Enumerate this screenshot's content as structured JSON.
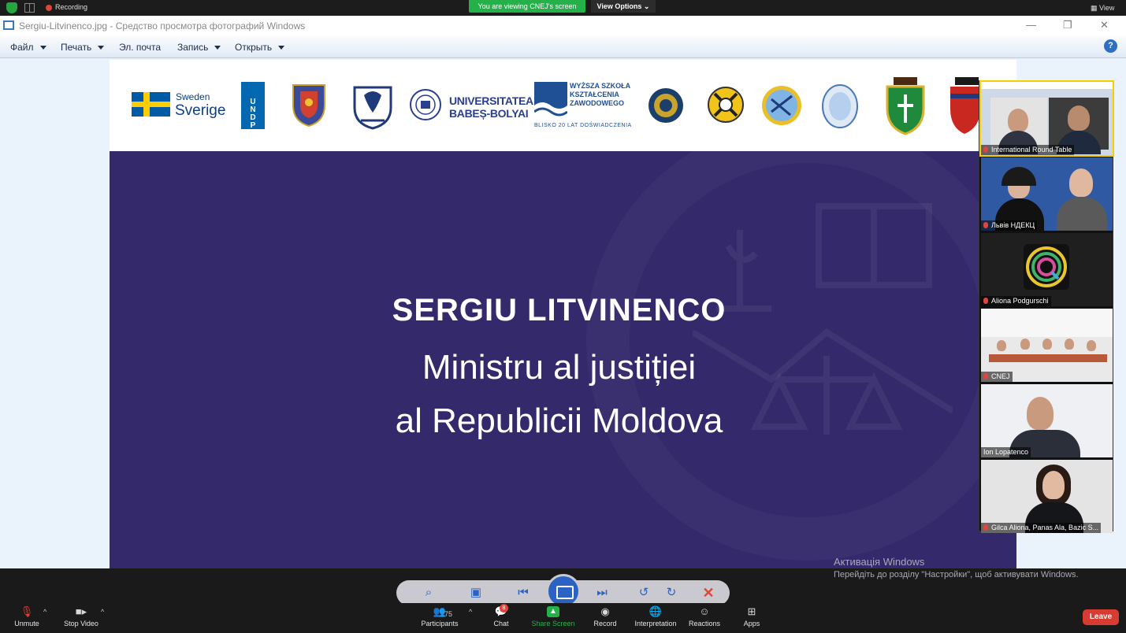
{
  "zoom": {
    "recording_label": "Recording",
    "viewing_banner": "You are viewing CNEJ's screen",
    "view_options": "View Options ⌄",
    "view_button": "View",
    "leave_label": "Leave",
    "toolbar": {
      "unmute": "Unmute",
      "stop_video": "Stop Video",
      "participants": "Participants",
      "participants_count": "75",
      "chat": "Chat",
      "chat_badge": "8",
      "share_screen": "Share Screen",
      "record": "Record",
      "interpretation": "Interpretation",
      "reactions": "Reactions",
      "apps": "Apps"
    },
    "gallery": [
      {
        "name": "International Round Table"
      },
      {
        "name": "Львів НДЕКЦ"
      },
      {
        "name": "Aliona Podgurschi"
      },
      {
        "name": "CNEJ"
      },
      {
        "name": "Ion Lopatenco"
      },
      {
        "name": "Gilca Aliona, Panas Ala, Bazic S..."
      }
    ]
  },
  "viewer": {
    "title": "Sergiu-Litvinenco.jpg - Средство просмотра фотографий Windows",
    "menu": [
      "Файл",
      "Печать",
      "Эл. почта",
      "Запись",
      "Открыть"
    ],
    "help": "?"
  },
  "slide": {
    "name": "SERGIU LITVINENCO",
    "line1": "Ministru al justiției",
    "line2": "al Republicii Moldova",
    "sweden_small": "Sweden",
    "sweden_big": "Sverige",
    "undp": [
      "U",
      "N",
      "D",
      "P"
    ],
    "ubb_1": "UNIVERSITATEA",
    "ubb_2": "BABEȘ-BOLYAI",
    "wsz_1": "WYŻSZA SZKOŁA",
    "wsz_2": "KSZTAŁCENIA",
    "wsz_3": "ZAWODOWEGO",
    "wsz_4": "BLISKO 20 LAT DOŚWIADCZENIA"
  },
  "windows_activation": {
    "title": "Активація Windows",
    "subtitle": "Перейдіть до розділу \"Настройки\", щоб активувати Windows."
  },
  "colors": {
    "slide_bg": "#33296b",
    "zoom_green": "#24b14a",
    "leave_red": "#d83b31"
  }
}
